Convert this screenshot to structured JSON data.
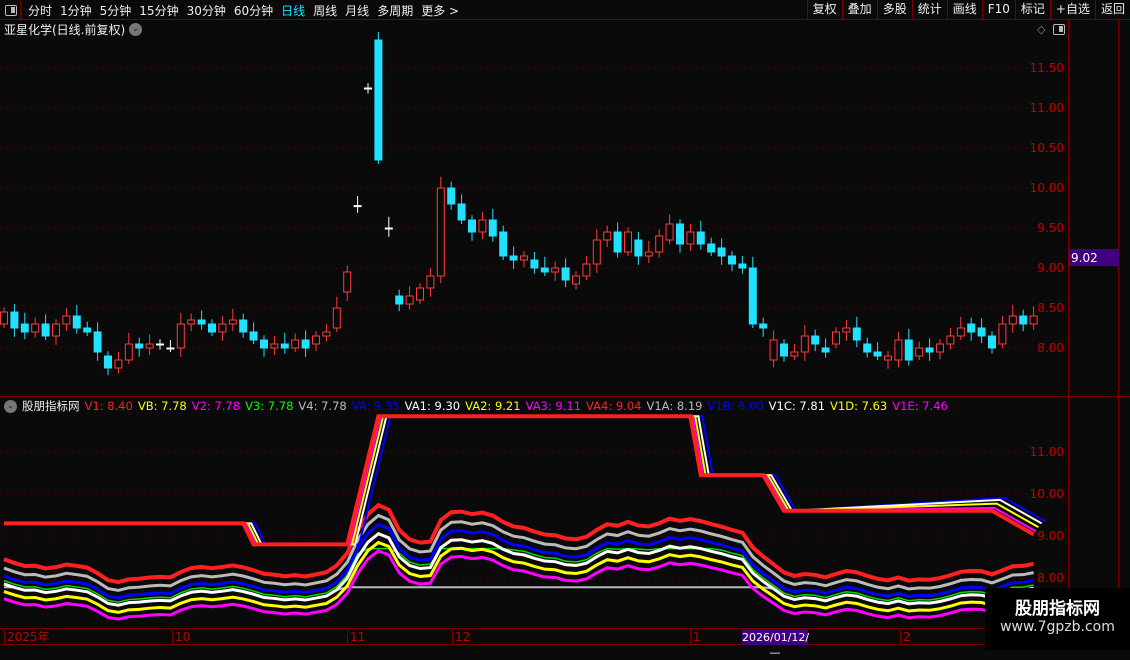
{
  "toolbar": {
    "periods": [
      "分时",
      "1分钟",
      "5分钟",
      "15分钟",
      "30分钟",
      "60分钟",
      "日线",
      "周线",
      "月线",
      "多周期",
      "更多 >"
    ],
    "active": "日线",
    "right_buttons": [
      "复权",
      "叠加",
      "多股",
      "统计",
      "画线",
      "F10",
      "标记",
      "+自选",
      "返回"
    ]
  },
  "chart": {
    "title": "亚星化学(日线.前复权)",
    "price_labels": [
      "11.50",
      "11.00",
      "10.50",
      "10.00",
      "9.50",
      "9.00",
      "8.50",
      "8.00"
    ],
    "current_price": "9.02",
    "colors": {
      "up": "#ff3b3b",
      "down": "#22e0ff"
    },
    "candles": [
      [
        8.3,
        8.45
      ],
      [
        8.45,
        8.25
      ],
      [
        8.3,
        8.2
      ],
      [
        8.2,
        8.3
      ],
      [
        8.3,
        8.15
      ],
      [
        8.15,
        8.3
      ],
      [
        8.3,
        8.4
      ],
      [
        8.4,
        8.25
      ],
      [
        8.25,
        8.2
      ],
      [
        8.2,
        7.95
      ],
      [
        7.9,
        7.75
      ],
      [
        7.75,
        7.85
      ],
      [
        7.85,
        8.05
      ],
      [
        8.05,
        8.0
      ],
      [
        8.0,
        8.05
      ],
      [
        8.05,
        8.05
      ],
      [
        8.0,
        8.0
      ],
      [
        8.0,
        8.3
      ],
      [
        8.3,
        8.35
      ],
      [
        8.35,
        8.3
      ],
      [
        8.3,
        8.2
      ],
      [
        8.2,
        8.3
      ],
      [
        8.3,
        8.35
      ],
      [
        8.35,
        8.2
      ],
      [
        8.2,
        8.1
      ],
      [
        8.1,
        8.0
      ],
      [
        8.0,
        8.05
      ],
      [
        8.05,
        8.0
      ],
      [
        8.0,
        8.1
      ],
      [
        8.1,
        8.0
      ],
      [
        8.05,
        8.15
      ],
      [
        8.15,
        8.2
      ],
      [
        8.25,
        8.5
      ],
      [
        8.7,
        8.95
      ],
      [
        9.78,
        9.78
      ],
      [
        11.25,
        11.25
      ],
      [
        11.85,
        10.35
      ],
      [
        9.5,
        9.5
      ],
      [
        8.65,
        8.55
      ],
      [
        8.55,
        8.65
      ],
      [
        8.6,
        8.75
      ],
      [
        8.75,
        8.9
      ],
      [
        8.9,
        10.0
      ],
      [
        10.0,
        9.8
      ],
      [
        9.8,
        9.6
      ],
      [
        9.6,
        9.45
      ],
      [
        9.45,
        9.6
      ],
      [
        9.6,
        9.4
      ],
      [
        9.45,
        9.15
      ],
      [
        9.15,
        9.1
      ],
      [
        9.1,
        9.15
      ],
      [
        9.1,
        9.0
      ],
      [
        9.0,
        8.95
      ],
      [
        8.95,
        9.0
      ],
      [
        9.0,
        8.85
      ],
      [
        8.8,
        8.9
      ],
      [
        8.9,
        9.05
      ],
      [
        9.05,
        9.35
      ],
      [
        9.35,
        9.45
      ],
      [
        9.45,
        9.2
      ],
      [
        9.2,
        9.45
      ],
      [
        9.35,
        9.15
      ],
      [
        9.15,
        9.2
      ],
      [
        9.2,
        9.4
      ],
      [
        9.35,
        9.55
      ],
      [
        9.55,
        9.3
      ],
      [
        9.3,
        9.45
      ],
      [
        9.45,
        9.3
      ],
      [
        9.3,
        9.2
      ],
      [
        9.25,
        9.15
      ],
      [
        9.15,
        9.05
      ],
      [
        9.05,
        9.0
      ],
      [
        9.0,
        8.3
      ],
      [
        8.3,
        8.25
      ],
      [
        7.85,
        8.1
      ],
      [
        8.05,
        7.9
      ],
      [
        7.9,
        7.95
      ],
      [
        7.95,
        8.15
      ],
      [
        8.15,
        8.05
      ],
      [
        8.0,
        7.95
      ],
      [
        8.05,
        8.2
      ],
      [
        8.2,
        8.25
      ],
      [
        8.25,
        8.1
      ],
      [
        8.05,
        7.95
      ],
      [
        7.95,
        7.9
      ],
      [
        7.85,
        7.9
      ],
      [
        7.85,
        8.1
      ],
      [
        8.1,
        7.85
      ],
      [
        7.9,
        8.0
      ],
      [
        8.0,
        7.95
      ],
      [
        7.95,
        8.05
      ],
      [
        8.05,
        8.15
      ],
      [
        8.15,
        8.25
      ],
      [
        8.3,
        8.2
      ],
      [
        8.25,
        8.15
      ],
      [
        8.15,
        8.0
      ],
      [
        8.05,
        8.3
      ],
      [
        8.3,
        8.4
      ],
      [
        8.4,
        8.3
      ],
      [
        8.3,
        8.4
      ]
    ]
  },
  "indicator": {
    "name": "股朋指标网",
    "legend": [
      {
        "label": "V1: 8.40",
        "color": "#ff2020"
      },
      {
        "label": "VB: 7.78",
        "color": "#ffff00"
      },
      {
        "label": "V2: 7.78",
        "color": "#ff00ff"
      },
      {
        "label": "V3: 7.78",
        "color": "#00ff00"
      },
      {
        "label": "V4: 7.78",
        "color": "#bbbbbb"
      },
      {
        "label": "VA: 9.35",
        "color": "#0000ff"
      },
      {
        "label": "VA1: 9.30",
        "color": "#ffffff"
      },
      {
        "label": "VA2: 9.21",
        "color": "#ffff00"
      },
      {
        "label": "VA3: 9.11",
        "color": "#ff00ff"
      },
      {
        "label": "VA4: 9.04",
        "color": "#ff2020"
      },
      {
        "label": "V1A: 8.19",
        "color": "#bbbbbb"
      },
      {
        "label": "V1B: 8.00",
        "color": "#0000ff"
      },
      {
        "label": "V1C: 7.81",
        "color": "#ffffff"
      },
      {
        "label": "V1D: 7.63",
        "color": "#ffff00"
      },
      {
        "label": "V1E: 7.46",
        "color": "#ff00ff"
      }
    ],
    "y_labels": [
      "11.00",
      "10.00",
      "9.00",
      "8.00"
    ],
    "va4_steps": [
      [
        0,
        9.3
      ],
      [
        23,
        9.3
      ],
      [
        24,
        8.8
      ],
      [
        33,
        8.8
      ],
      [
        36,
        11.85
      ],
      [
        66,
        11.85
      ],
      [
        67,
        10.45
      ],
      [
        73,
        10.45
      ],
      [
        75,
        9.6
      ],
      [
        95,
        9.6
      ],
      [
        99,
        9.04
      ]
    ]
  },
  "xaxis": {
    "labels": [
      "2025年",
      "10",
      "11",
      "12",
      "1",
      "2"
    ],
    "cursor_date": "2026/01/12/—"
  },
  "watermark": {
    "name": "股朋指标网",
    "url": "www.7gpzb.com"
  }
}
